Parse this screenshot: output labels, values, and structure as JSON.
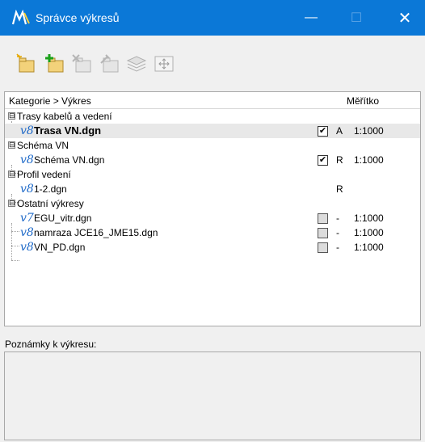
{
  "window": {
    "title": "Správce výkresů",
    "minimize_glyph": "—",
    "maximize_glyph": "☐",
    "close_glyph": "✕"
  },
  "toolbar": {
    "icons": [
      "new-category-icon",
      "new-drawing-icon",
      "delete-icon",
      "properties-icon",
      "layers-icon",
      "move-icon"
    ]
  },
  "tree": {
    "column_category": "Kategorie > Výkres",
    "column_scale": "Měřítko",
    "categories": [
      {
        "label": "Trasy kabelů a vedení",
        "expander": "⊟"
      },
      {
        "label": "Schéma VN",
        "expander": "⊟"
      },
      {
        "label": "Profil vedení",
        "expander": "⊟"
      },
      {
        "label": "Ostatní výkresy",
        "expander": "⊟"
      }
    ],
    "drawings": [
      {
        "version": "v8",
        "name": "Trasa VN.dgn",
        "checked": true,
        "check_glyph": "✔",
        "flag": "A",
        "scale": "1:1000"
      },
      {
        "version": "v8",
        "name": "Schéma VN.dgn",
        "checked": true,
        "check_glyph": "✔",
        "flag": "R",
        "scale": "1:1000"
      },
      {
        "version": "v8",
        "name": "1-2.dgn",
        "flag": "R",
        "scale": ""
      },
      {
        "version": "v7",
        "name": "EGU_vitr.dgn",
        "checked": false,
        "flag": "-",
        "scale": "1:1000"
      },
      {
        "version": "v8",
        "name": "namraza JCE16_JME15.dgn",
        "checked": false,
        "flag": "-",
        "scale": "1:1000"
      },
      {
        "version": "v8",
        "name": "VN_PD.dgn",
        "checked": false,
        "flag": "-",
        "scale": "1:1000"
      }
    ]
  },
  "notes": {
    "label": "Poznámky k výkresu:"
  }
}
